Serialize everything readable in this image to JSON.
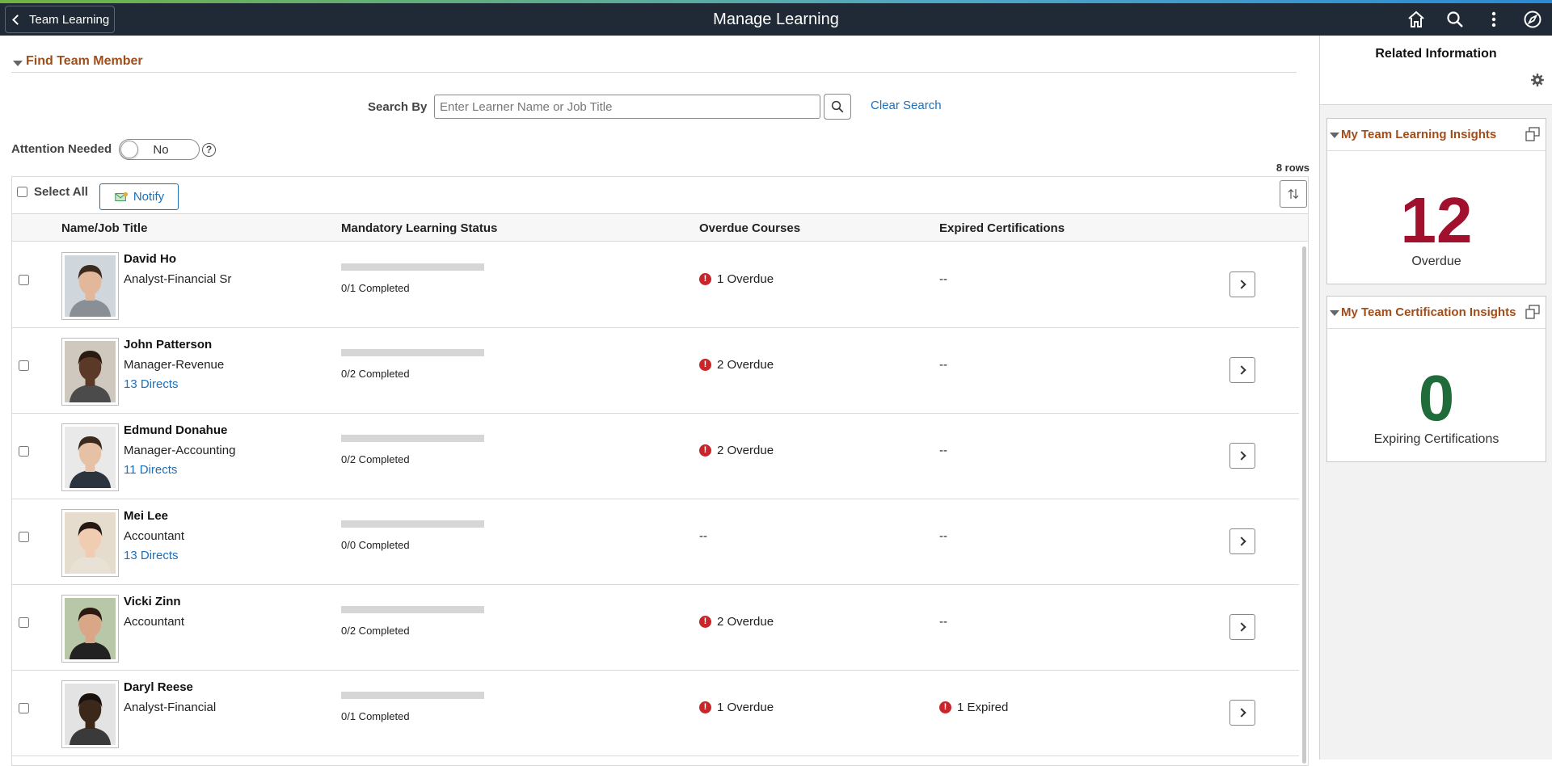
{
  "header": {
    "back_label": "Team Learning",
    "title": "Manage Learning",
    "icons": [
      "home-icon",
      "search-icon",
      "more-vertical-icon",
      "compass-icon"
    ]
  },
  "find": {
    "section_title": "Find Team Member",
    "search_label": "Search By",
    "search_placeholder": "Enter Learner Name or Job Title",
    "search_value": "",
    "clear_label": "Clear Search",
    "attention_label": "Attention Needed",
    "attention_value": "No",
    "help_glyph": "?"
  },
  "grid": {
    "row_count": "8 rows",
    "select_all_label": "Select All",
    "notify_label": "Notify",
    "columns": [
      "Name/Job Title",
      "Mandatory Learning Status",
      "Overdue Courses",
      "Expired Certifications"
    ],
    "rows": [
      {
        "name": "David Ho",
        "job": "Analyst-Financial Sr",
        "directs": "",
        "progress": 0,
        "completed": "0/1 Completed",
        "overdue": "1 Overdue",
        "overdue_alert": true,
        "expired": "--",
        "expired_alert": false,
        "skin": "#e2b79a",
        "hair": "#3b2a1e",
        "shirt": "#8a8f96",
        "bg": "#cfd6dc"
      },
      {
        "name": "John Patterson",
        "job": "Manager-Revenue",
        "directs": "13 Directs",
        "progress": 0,
        "completed": "0/2 Completed",
        "overdue": "2 Overdue",
        "overdue_alert": true,
        "expired": "--",
        "expired_alert": false,
        "skin": "#5a3a26",
        "hair": "#2a1a10",
        "shirt": "#4b4b4b",
        "bg": "#cfc8bf"
      },
      {
        "name": "Edmund Donahue",
        "job": "Manager-Accounting",
        "directs": "11 Directs",
        "progress": 0,
        "completed": "0/2 Completed",
        "overdue": "2 Overdue",
        "overdue_alert": true,
        "expired": "--",
        "expired_alert": false,
        "skin": "#e6c1a6",
        "hair": "#3d2a1c",
        "shirt": "#2c3440",
        "bg": "#e9e9e9"
      },
      {
        "name": "Mei Lee",
        "job": "Accountant",
        "directs": "13 Directs",
        "progress": 0,
        "completed": "0/0 Completed",
        "overdue": "--",
        "overdue_alert": false,
        "expired": "--",
        "expired_alert": false,
        "skin": "#f0cdb1",
        "hair": "#231812",
        "shirt": "#e8e2d6",
        "bg": "#e6dccd"
      },
      {
        "name": "Vicki Zinn",
        "job": "Accountant",
        "directs": "",
        "progress": 0,
        "completed": "0/2 Completed",
        "overdue": "2 Overdue",
        "overdue_alert": true,
        "expired": "--",
        "expired_alert": false,
        "skin": "#d9a787",
        "hair": "#2b1a12",
        "shirt": "#222222",
        "bg": "#b9c7a9"
      },
      {
        "name": "Daryl Reese",
        "job": "Analyst-Financial",
        "directs": "",
        "progress": 0,
        "completed": "0/1 Completed",
        "overdue": "1 Overdue",
        "overdue_alert": true,
        "expired": "1 Expired",
        "expired_alert": true,
        "skin": "#3c271b",
        "hair": "#1a110b",
        "shirt": "#3a3a3a",
        "bg": "#e3e3e3"
      }
    ]
  },
  "related": {
    "title": "Related Information",
    "tiles": [
      {
        "title": "My Team Learning Insights",
        "value": "12",
        "caption": "Overdue",
        "color": "#a1112e"
      },
      {
        "title": "My Team Certification Insights",
        "value": "0",
        "caption": "Expiring Certifications",
        "color": "#1f6b3a"
      }
    ]
  },
  "colors": {
    "header_bg": "#1f2a36",
    "section_title": "#a14d1a",
    "link": "#1d6fb8",
    "alert": "#c8262b"
  }
}
